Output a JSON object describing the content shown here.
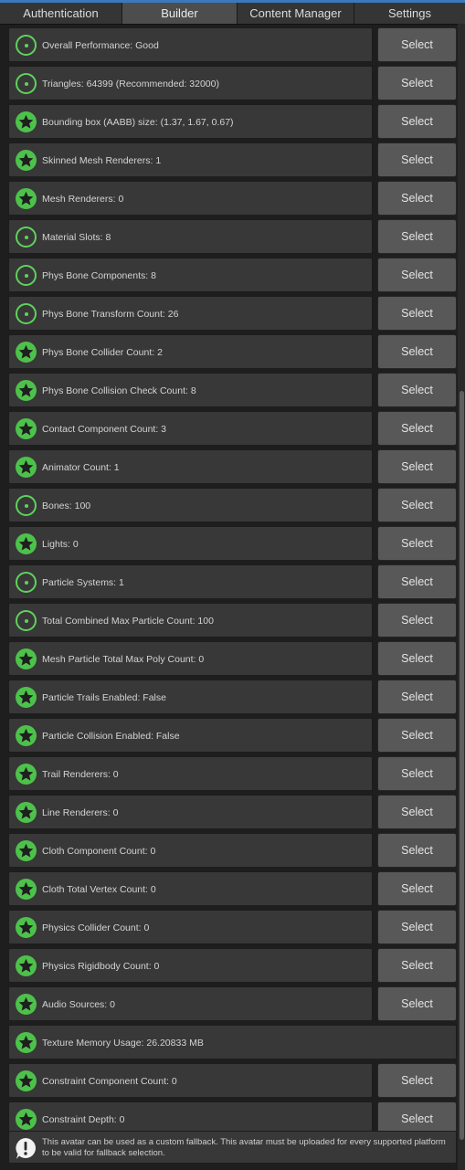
{
  "tabs": [
    {
      "label": "Authentication",
      "active": false
    },
    {
      "label": "Builder",
      "active": true
    },
    {
      "label": "Content Manager",
      "active": false
    },
    {
      "label": "Settings",
      "active": false
    }
  ],
  "colors": {
    "accent": "#3a79bb",
    "status_green": "#5fd25c",
    "panel_bg": "#383838",
    "button_bg": "#585858"
  },
  "select_label": "Select",
  "rows": [
    {
      "label": "Overall Performance: Good",
      "icon": "ring-icon",
      "has_select": true
    },
    {
      "label": "Triangles: 64399 (Recommended: 32000)",
      "icon": "ring-icon",
      "has_select": true
    },
    {
      "label": "Bounding box (AABB) size: (1.37, 1.67, 0.67)",
      "icon": "star-icon",
      "has_select": true
    },
    {
      "label": "Skinned Mesh Renderers: 1",
      "icon": "star-icon",
      "has_select": true
    },
    {
      "label": "Mesh Renderers: 0",
      "icon": "star-icon",
      "has_select": true
    },
    {
      "label": "Material Slots: 8",
      "icon": "ring-icon",
      "has_select": true
    },
    {
      "label": "Phys Bone Components: 8",
      "icon": "ring-icon",
      "has_select": true
    },
    {
      "label": "Phys Bone Transform Count: 26",
      "icon": "ring-icon",
      "has_select": true
    },
    {
      "label": "Phys Bone Collider Count: 2",
      "icon": "star-icon",
      "has_select": true
    },
    {
      "label": "Phys Bone Collision Check Count: 8",
      "icon": "star-icon",
      "has_select": true
    },
    {
      "label": "Contact Component Count: 3",
      "icon": "star-icon",
      "has_select": true
    },
    {
      "label": "Animator Count: 1",
      "icon": "star-icon",
      "has_select": true
    },
    {
      "label": "Bones: 100",
      "icon": "ring-icon",
      "has_select": true
    },
    {
      "label": "Lights: 0",
      "icon": "star-icon",
      "has_select": true
    },
    {
      "label": "Particle Systems: 1",
      "icon": "ring-icon",
      "has_select": true
    },
    {
      "label": "Total Combined Max Particle Count: 100",
      "icon": "ring-icon",
      "has_select": true
    },
    {
      "label": "Mesh Particle Total Max Poly Count: 0",
      "icon": "star-icon",
      "has_select": true
    },
    {
      "label": "Particle Trails Enabled: False",
      "icon": "star-icon",
      "has_select": true
    },
    {
      "label": "Particle Collision Enabled: False",
      "icon": "star-icon",
      "has_select": true
    },
    {
      "label": "Trail Renderers: 0",
      "icon": "star-icon",
      "has_select": true
    },
    {
      "label": "Line Renderers: 0",
      "icon": "star-icon",
      "has_select": true
    },
    {
      "label": "Cloth Component Count: 0",
      "icon": "star-icon",
      "has_select": true
    },
    {
      "label": "Cloth Total Vertex Count: 0",
      "icon": "star-icon",
      "has_select": true
    },
    {
      "label": "Physics Collider Count: 0",
      "icon": "star-icon",
      "has_select": true
    },
    {
      "label": "Physics Rigidbody Count: 0",
      "icon": "star-icon",
      "has_select": true
    },
    {
      "label": "Audio Sources: 0",
      "icon": "star-icon",
      "has_select": true
    },
    {
      "label": "Texture Memory Usage: 26.20833 MB",
      "icon": "star-icon",
      "has_select": false
    },
    {
      "label": "Constraint Component Count: 0",
      "icon": "star-icon",
      "has_select": true
    },
    {
      "label": "Constraint Depth: 0",
      "icon": "star-icon",
      "has_select": true
    }
  ],
  "fallback_info": {
    "icon": "info-warning-icon",
    "text": "This avatar can be used as a custom fallback. This avatar must be uploaded for every supported platform to be valid for fallback selection."
  }
}
